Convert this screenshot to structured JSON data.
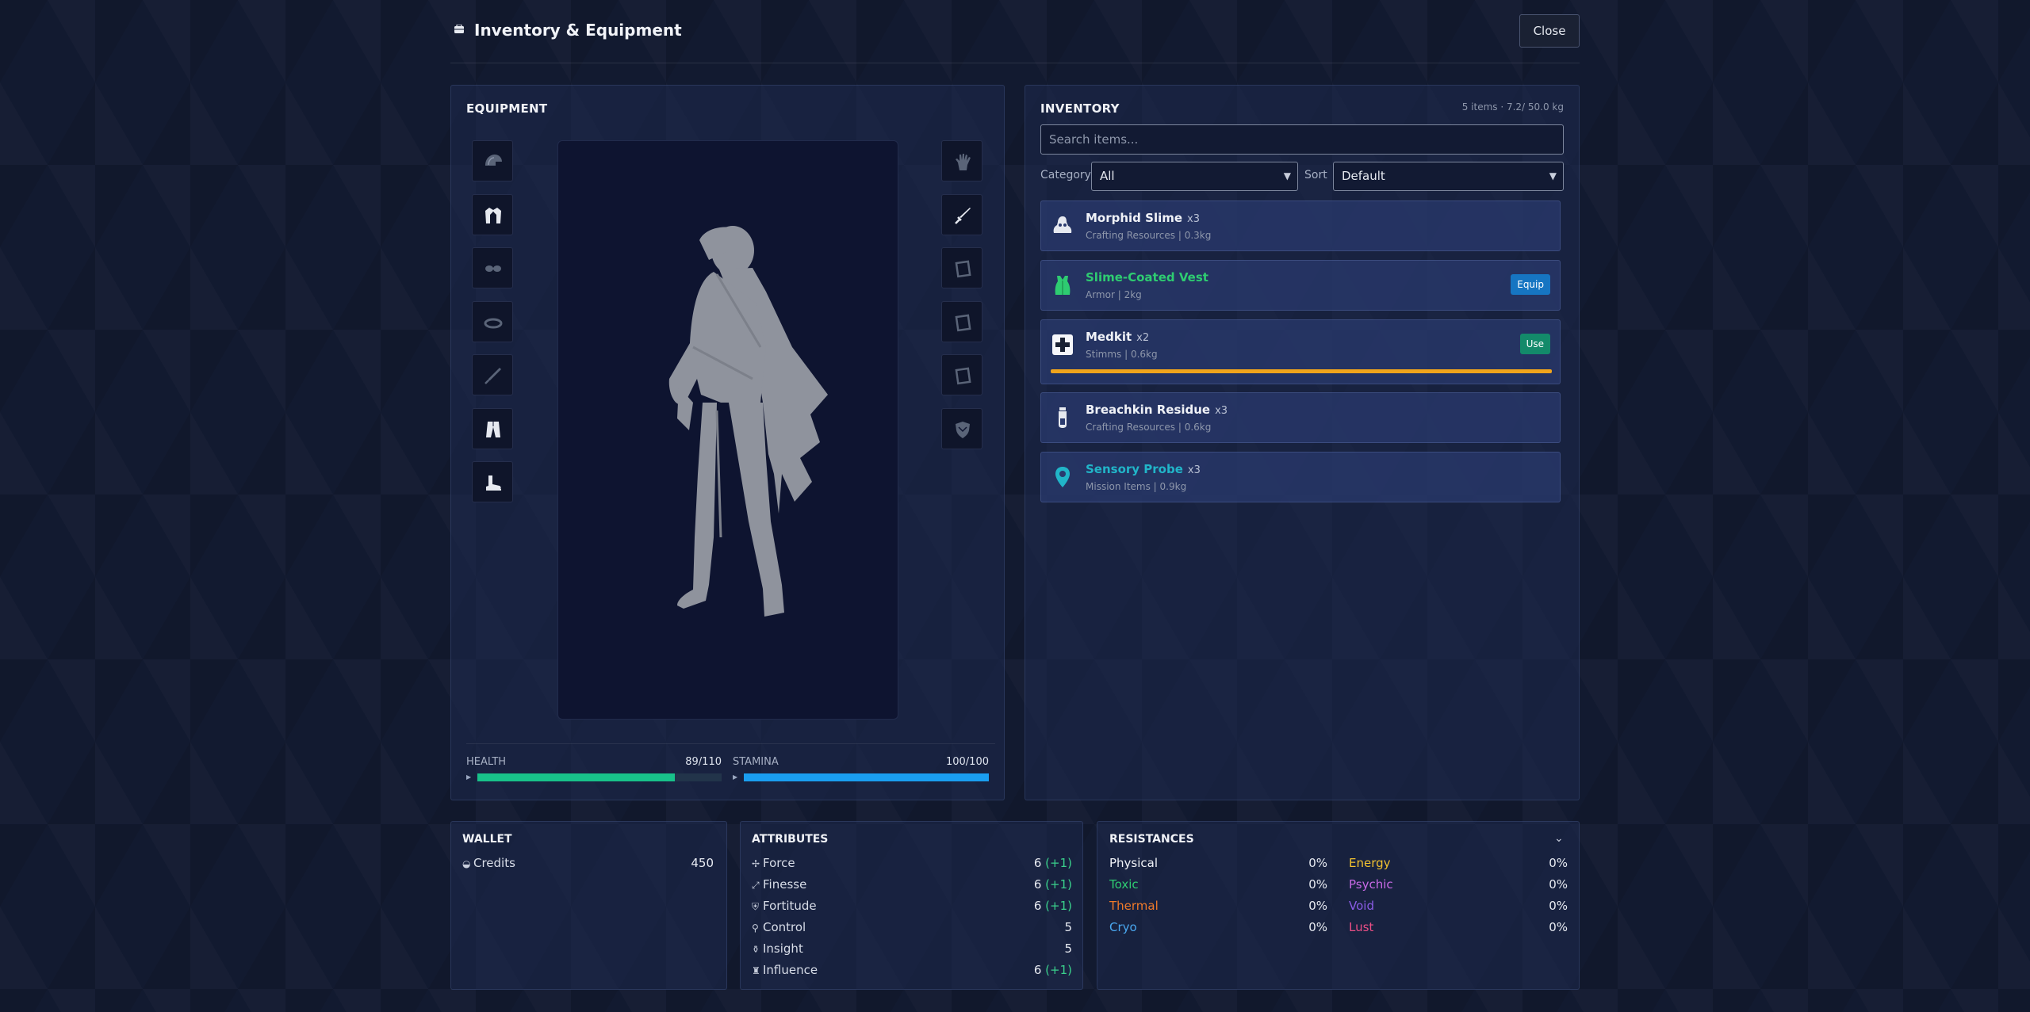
{
  "header": {
    "title": "Inventory & Equipment",
    "close_label": "Close"
  },
  "equipment": {
    "title": "EQUIPMENT",
    "left_slots": [
      "helmet-icon",
      "jacket-icon",
      "goggles-icon",
      "ring-icon",
      "knife-icon",
      "pants-icon",
      "boots-icon"
    ],
    "right_slots": [
      "gloves-icon",
      "sword-icon",
      "empty-slot-icon",
      "empty-slot-icon",
      "empty-slot-icon",
      "shield-icon"
    ],
    "stats": {
      "health": {
        "label": "HEALTH",
        "value": "89/110",
        "fraction": 0.809
      },
      "stamina": {
        "label": "STAMINA",
        "value": "100/100",
        "fraction": 1.0
      }
    }
  },
  "inventory": {
    "title": "INVENTORY",
    "summary": "5 items · 7.2/ 50.0 kg",
    "search_placeholder": "Search items...",
    "category_label": "Category",
    "category_value": "All",
    "sort_label": "Sort",
    "sort_value": "Default",
    "items": [
      {
        "name": "Morphid Slime",
        "qty": "x3",
        "category": "Crafting Resources",
        "weight": "0.3kg",
        "icon": "slime-icon",
        "name_color": "#f0f2f7",
        "action": ""
      },
      {
        "name": "Slime-Coated Vest",
        "qty": "",
        "category": "Armor",
        "weight": "2kg",
        "icon": "vest-icon",
        "name_color": "#2ecc71",
        "action": "Equip"
      },
      {
        "name": "Medkit",
        "qty": "x2",
        "category": "Stimms",
        "weight": "0.6kg",
        "icon": "medkit-icon",
        "name_color": "#f0f2f7",
        "action": "Use"
      },
      {
        "name": "Breachkin Residue",
        "qty": "x3",
        "category": "Crafting Resources",
        "weight": "0.6kg",
        "icon": "vial-icon",
        "name_color": "#f0f2f7",
        "action": ""
      },
      {
        "name": "Sensory Probe",
        "qty": "x3",
        "category": "Mission Items",
        "weight": "0.9kg",
        "icon": "location-pin-icon",
        "name_color": "#21b5c8",
        "action": ""
      }
    ]
  },
  "wallet": {
    "title": "WALLET",
    "credits_label": "Credits",
    "credits_value": "450"
  },
  "attributes": {
    "title": "ATTRIBUTES",
    "rows": [
      {
        "label": "Force",
        "value": "6",
        "bonus": "(+1)"
      },
      {
        "label": "Finesse",
        "value": "6",
        "bonus": "(+1)"
      },
      {
        "label": "Fortitude",
        "value": "6",
        "bonus": "(+1)"
      },
      {
        "label": "Control",
        "value": "5",
        "bonus": ""
      },
      {
        "label": "Insight",
        "value": "5",
        "bonus": ""
      },
      {
        "label": "Influence",
        "value": "6",
        "bonus": "(+1)"
      }
    ]
  },
  "resistances": {
    "title": "RESISTANCES",
    "left": [
      {
        "label": "Physical",
        "value": "0%",
        "color": "#f0f2f7"
      },
      {
        "label": "Toxic",
        "value": "0%",
        "color": "#2ecc71"
      },
      {
        "label": "Thermal",
        "value": "0%",
        "color": "#f07a2a"
      },
      {
        "label": "Cryo",
        "value": "0%",
        "color": "#4aa8f0"
      }
    ],
    "right": [
      {
        "label": "Energy",
        "value": "0%",
        "color": "#f2c230"
      },
      {
        "label": "Psychic",
        "value": "0%",
        "color": "#c86ae6"
      },
      {
        "label": "Void",
        "value": "0%",
        "color": "#8a5ce6"
      },
      {
        "label": "Lust",
        "value": "0%",
        "color": "#ec4f86"
      }
    ]
  }
}
